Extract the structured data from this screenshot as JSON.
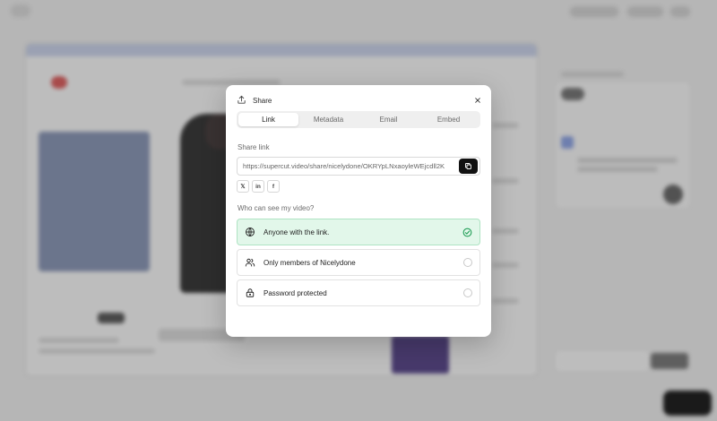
{
  "modal": {
    "title": "Share",
    "tabs": [
      {
        "label": "Link",
        "active": true
      },
      {
        "label": "Metadata",
        "active": false
      },
      {
        "label": "Email",
        "active": false
      },
      {
        "label": "Embed",
        "active": false
      }
    ],
    "share_link_label": "Share link",
    "share_link_value": "https://supercut.video/share/nicelydone/OKRYpLNxaoyleWEjcdll2K",
    "social": [
      {
        "label": "𝕏",
        "icon": "x-icon"
      },
      {
        "label": "in",
        "icon": "linkedin-icon"
      },
      {
        "label": "f",
        "icon": "facebook-icon"
      }
    ],
    "visibility_label": "Who can see my video?",
    "options": [
      {
        "label": "Anyone with the link.",
        "icon": "globe-icon",
        "selected": true
      },
      {
        "label": "Only members of Nicelydone",
        "icon": "users-icon",
        "selected": false
      },
      {
        "label": "Password protected",
        "icon": "lock-icon",
        "selected": false
      }
    ]
  },
  "colors": {
    "selected_bg": "#e2f7ea",
    "selected_check": "#1f9d55",
    "copy_button": "#111111"
  }
}
